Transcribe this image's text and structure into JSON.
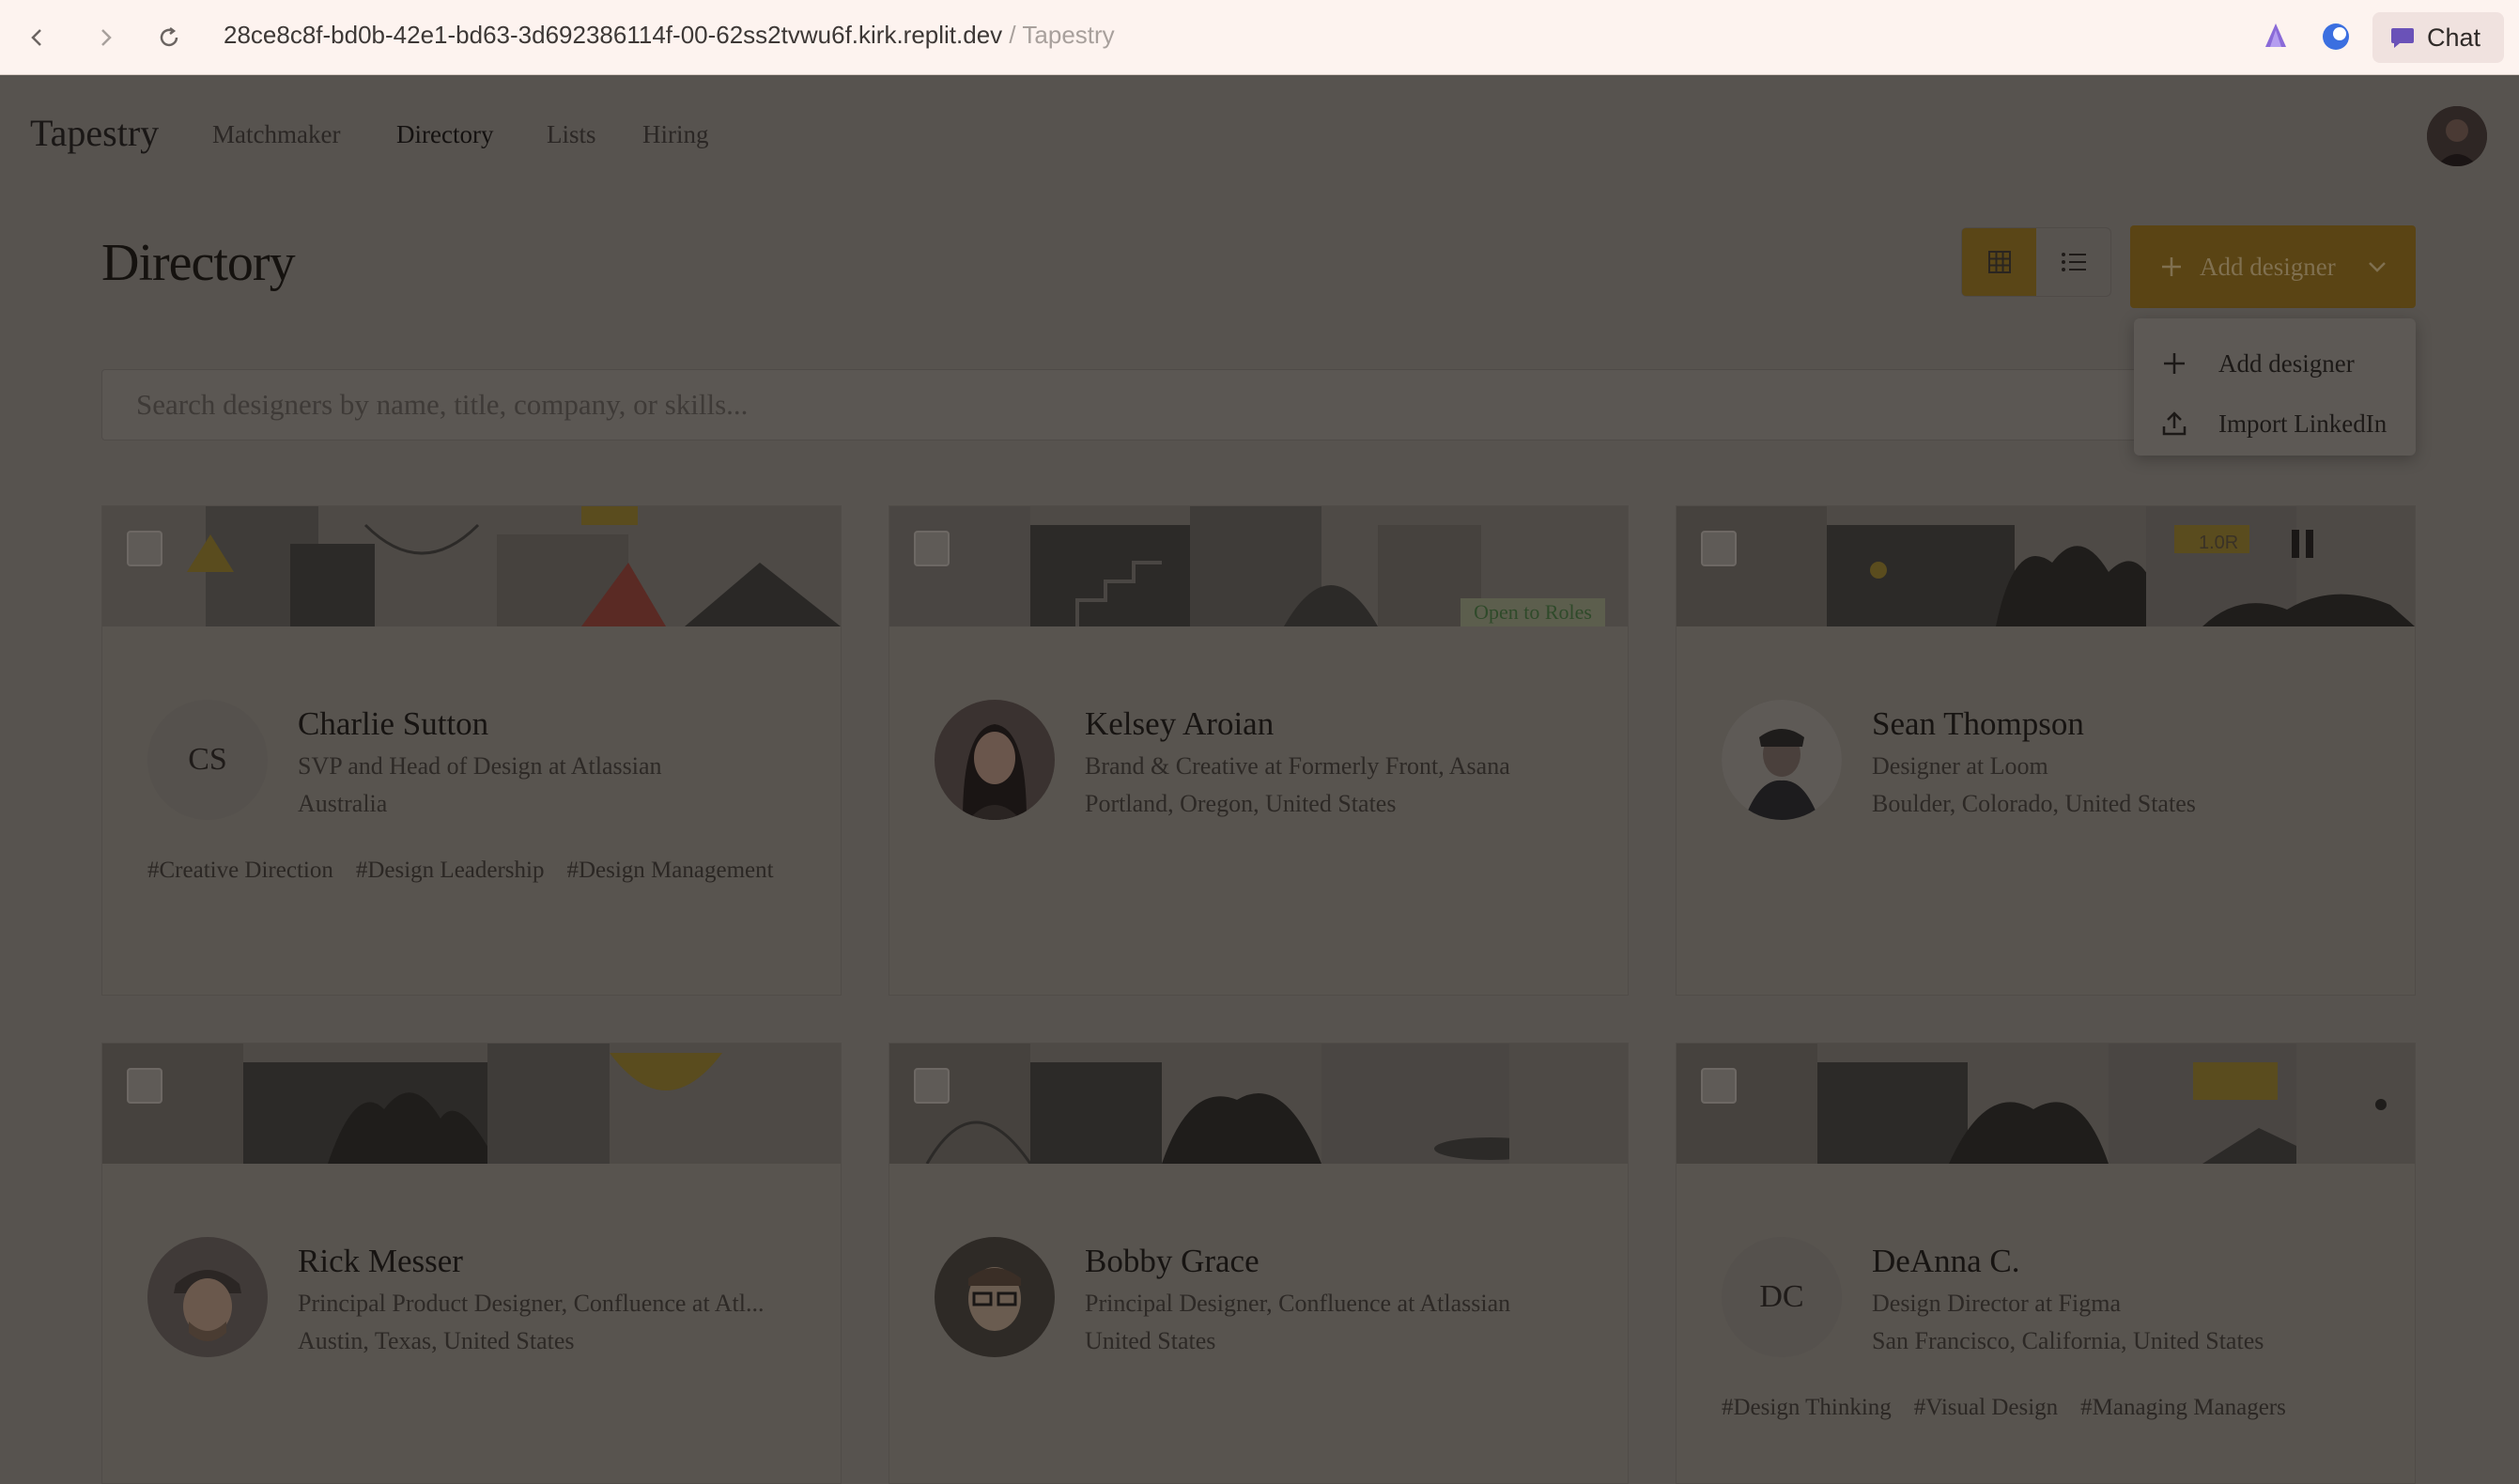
{
  "browser": {
    "url": "28ce8c8f-bd0b-42e1-bd63-3d692386114f-00-62ss2tvwu6f.kirk.replit.dev",
    "separator": "/",
    "tab_title": "Tapestry",
    "chat_label": "Chat"
  },
  "app": {
    "logo": "Tapestry",
    "nav": [
      "Matchmaker",
      "Directory",
      "Lists",
      "Hiring"
    ],
    "active_nav": "Directory"
  },
  "header": {
    "title": "Directory",
    "add_button_label": "Add designer"
  },
  "dropdown": {
    "items": [
      {
        "label": "Add designer",
        "icon": "plus-icon"
      },
      {
        "label": "Import LinkedIn",
        "icon": "upload-icon"
      }
    ]
  },
  "search": {
    "placeholder": "Search designers by name, title, company, or skills..."
  },
  "cards": [
    {
      "initials": "CS",
      "name": "Charlie Sutton",
      "role": "SVP and Head of Design at Atlassian",
      "location": "Australia",
      "badge": "",
      "tags": [
        "#Creative Direction",
        "#Design Leadership",
        "#Design Management"
      ]
    },
    {
      "initials": "",
      "name": "Kelsey Aroian",
      "role": "Brand & Creative at Formerly Front, Asana",
      "location": "Portland, Oregon, United States",
      "badge": "Open to Roles",
      "tags": []
    },
    {
      "initials": "",
      "name": "Sean Thompson",
      "role": "Designer at Loom",
      "location": "Boulder, Colorado, United States",
      "badge": "",
      "tags": []
    },
    {
      "initials": "",
      "name": "Rick Messer",
      "role": "Principal Product Designer, Confluence at Atl...",
      "location": "Austin, Texas, United States",
      "badge": "",
      "tags": []
    },
    {
      "initials": "",
      "name": "Bobby Grace",
      "role": "Principal Designer, Confluence at Atlassian",
      "location": "United States",
      "badge": "",
      "tags": []
    },
    {
      "initials": "DC",
      "name": "DeAnna C.",
      "role": "Design Director at Figma",
      "location": "San Francisco, California, United States",
      "badge": "",
      "tags": [
        "#Design Thinking",
        "#Visual Design",
        "#Managing Managers"
      ]
    }
  ],
  "banner_text": [
    "1.0R"
  ]
}
